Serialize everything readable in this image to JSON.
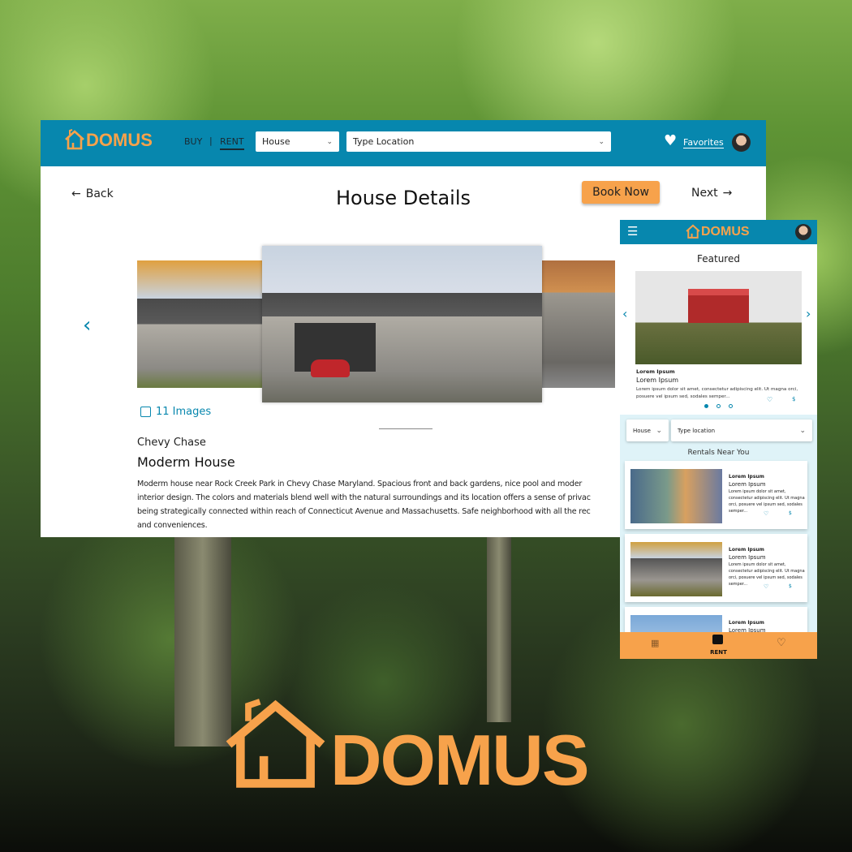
{
  "brand": {
    "name": "DOMUS",
    "color": "#f7a24b",
    "header_color": "#0787ae"
  },
  "desktop": {
    "nav": {
      "buy": "BUY",
      "separator": "|",
      "rent": "RENT"
    },
    "type_select": "House",
    "location_select": "Type Location",
    "favorites": "Favorites",
    "back": "Back",
    "title": "House Details",
    "book_now": "Book Now",
    "next": "Next",
    "images_count": "11 Images",
    "location": "Chevy Chase",
    "name": "Moderm House",
    "description_lines": [
      "Moderm house near Rock Creek Park in Chevy Chase Maryland. Spacious front and back gardens, nice pool and moder",
      "interior design. The colors and materials blend well with the natural surroundings and its location offers a sense of privac",
      "being strategically connected within reach of Connecticut Avenue and Massachusetts. Safe neighborhood with all the rec",
      "and conveniences."
    ]
  },
  "mobile": {
    "featured_title": "Featured",
    "featured": {
      "label": "Lorem Ipsum",
      "title": "Lorem Ipsum",
      "text": "Lorem ipsum dolor sit amet, consectetur adipiscing elit. Ut magna orci, posuere vel ipsum sed, sodales semper...",
      "price_icon": "$"
    },
    "type_select": "House",
    "location_select": "Type location",
    "rentals_title": "Rentals Near You",
    "rentals": [
      {
        "label": "Lorem Ipsum",
        "title": "Lorem Ipsum",
        "text": "Lorem ipsum dolor sit amet, consectetur adipiscing elit. Ut magna orci, posuere vel ipsum sed, sodales semper...",
        "price_icon": "$"
      },
      {
        "label": "Lorem Ipsum",
        "title": "Lorem Ipsum",
        "text": "Lorem ipsum dolor sit amet, consectetur adipiscing elit. Ut magna orci, posuere vel ipsum sed, sodales semper...",
        "price_icon": "$"
      },
      {
        "label": "Lorem Ipsum",
        "title": "Lorem Ipsum"
      }
    ],
    "bottom_nav": {
      "active": "RENT"
    }
  }
}
